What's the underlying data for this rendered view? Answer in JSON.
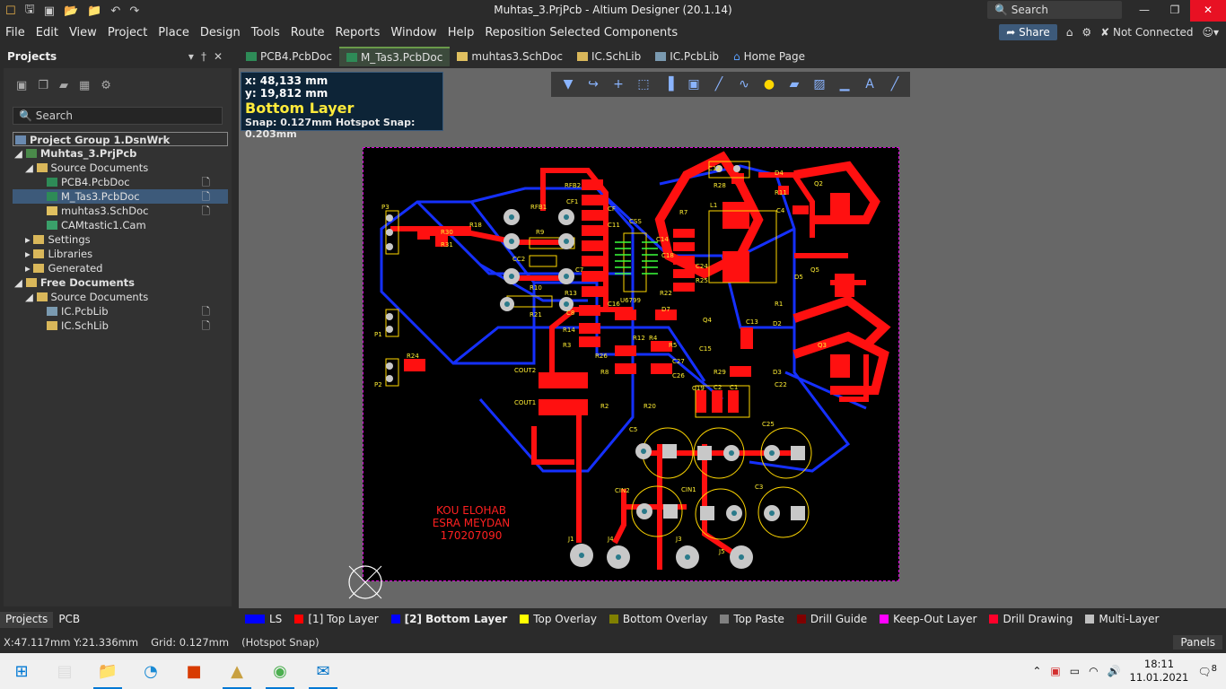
{
  "window": {
    "title": "Muhtas_3.PrjPcb - Altium Designer (20.1.14)",
    "search": "Search"
  },
  "menu": [
    "File",
    "Edit",
    "View",
    "Project",
    "Place",
    "Design",
    "Tools",
    "Route",
    "Reports",
    "Window",
    "Help",
    "Reposition Selected Components"
  ],
  "menu_right": {
    "share": "Share",
    "connection": "Not Connected"
  },
  "projects_panel": {
    "title": "Projects",
    "search_placeholder": "Search",
    "tree": [
      {
        "label": "Project Group 1.DsnWrk",
        "level": 0,
        "bold": true
      },
      {
        "label": "Muhtas_3.PrjPcb",
        "level": 0,
        "bold": true
      },
      {
        "label": "Source Documents",
        "level": 1
      },
      {
        "label": "PCB4.PcbDoc",
        "level": 2
      },
      {
        "label": "M_Tas3.PcbDoc",
        "level": 2,
        "selected": true
      },
      {
        "label": "muhtas3.SchDoc",
        "level": 2
      },
      {
        "label": "CAMtastic1.Cam",
        "level": 2
      },
      {
        "label": "Settings",
        "level": 1
      },
      {
        "label": "Libraries",
        "level": 1
      },
      {
        "label": "Generated",
        "level": 1
      },
      {
        "label": "Free Documents",
        "level": 0,
        "bold": true
      },
      {
        "label": "Source Documents",
        "level": 1
      },
      {
        "label": "IC.PcbLib",
        "level": 2
      },
      {
        "label": "IC.SchLib",
        "level": 2
      }
    ],
    "bottom_tabs": [
      "Projects",
      "PCB"
    ]
  },
  "doc_tabs": [
    {
      "label": "PCB4.PcbDoc",
      "active": false
    },
    {
      "label": "M_Tas3.PcbDoc",
      "active": true
    },
    {
      "label": "muhtas3.SchDoc",
      "active": false
    },
    {
      "label": "IC.SchLib",
      "active": false
    },
    {
      "label": "IC.PcbLib",
      "active": false
    },
    {
      "label": "Home Page",
      "active": false
    }
  ],
  "heads_up": {
    "x": "x: 48,133 mm",
    "y": "y: 19,812 mm",
    "layer": "Bottom Layer",
    "snap": "Snap: 0.127mm Hotspot Snap: 0.203mm"
  },
  "board": {
    "silk_text": [
      "KOU ELOHAB",
      "ESRA MEYDAN",
      "170207090"
    ],
    "labels": [
      "RFB2",
      "CF1",
      "CF",
      "RFB1",
      "R9",
      "CC2",
      "R10",
      "R21",
      "C11",
      "CSS",
      "C7",
      "R13",
      "C8",
      "R14",
      "R3",
      "R26",
      "R8",
      "R12",
      "R4",
      "R5",
      "COUT2",
      "COUT1",
      "R2",
      "R20",
      "C5",
      "C25",
      "CIN2",
      "CIN1",
      "C3",
      "J1",
      "J4",
      "J3",
      "J5",
      "P3",
      "P1",
      "P2",
      "R30",
      "R31",
      "R18",
      "R24",
      "C12",
      "D4",
      "R28",
      "R11",
      "C4",
      "Q2",
      "L1",
      "R7",
      "C14",
      "C18",
      "C24",
      "R25",
      "R22",
      "D7",
      "Q4",
      "C13",
      "D5",
      "D2",
      "R1",
      "Q3",
      "C15",
      "C27",
      "C26",
      "R29",
      "D3",
      "C22",
      "C19",
      "C2",
      "C1",
      "Q5",
      "U6799",
      "C16"
    ]
  },
  "layers": [
    {
      "label": "LS",
      "color": "#0000ff"
    },
    {
      "label": "[1] Top Layer",
      "color": "#ff0000"
    },
    {
      "label": "[2] Bottom Layer",
      "color": "#0000ff",
      "active": true
    },
    {
      "label": "Top Overlay",
      "color": "#ffff00"
    },
    {
      "label": "Bottom Overlay",
      "color": "#808000"
    },
    {
      "label": "Top Paste",
      "color": "#808080"
    },
    {
      "label": "Drill Guide",
      "color": "#800000"
    },
    {
      "label": "Keep-Out Layer",
      "color": "#ff00ff"
    },
    {
      "label": "Drill Drawing",
      "color": "#ff002a"
    },
    {
      "label": "Multi-Layer",
      "color": "#c0c0c0"
    }
  ],
  "status": {
    "coords": "X:47.117mm Y:21.336mm",
    "grid": "Grid: 0.127mm",
    "snap": "(Hotspot Snap)",
    "panels": "Panels"
  },
  "taskbar": {
    "time": "18:11",
    "date": "11.01.2021",
    "notifications": "8"
  }
}
